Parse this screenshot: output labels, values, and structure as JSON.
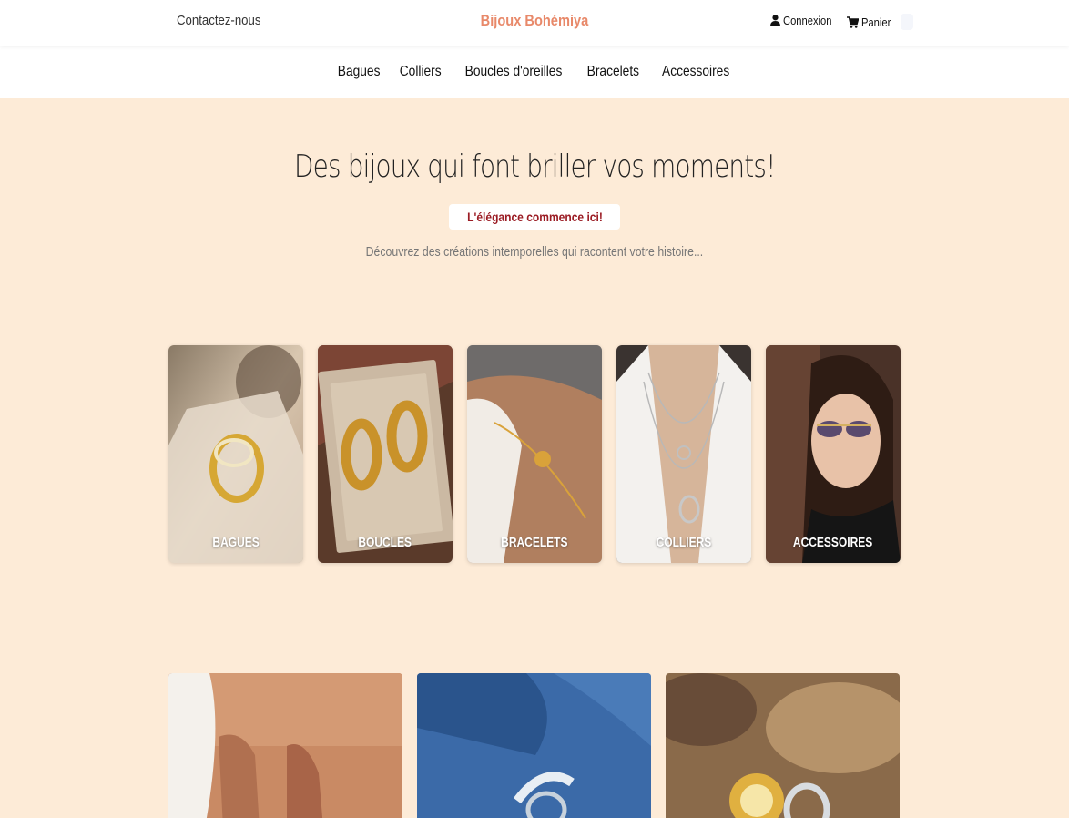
{
  "topbar": {
    "contact_label": "Contactez-nous",
    "brand": "Bijoux Bohémiya",
    "account_icon": "user-icon",
    "account_label": "Connexion",
    "cart_icon": "cart-icon",
    "cart_label": "Panier"
  },
  "nav": {
    "items": [
      {
        "label": "Bagues"
      },
      {
        "label": "Colliers"
      },
      {
        "label": "Boucles d'oreilles"
      },
      {
        "label": "Bracelets"
      },
      {
        "label": "Accessoires"
      }
    ]
  },
  "hero": {
    "title": "Des bijoux qui font briller vos moments!",
    "badge": "L'élégance commence ici!",
    "subtitle": "Découvrez des créations intemporelles qui racontent votre histoire..."
  },
  "categories": [
    {
      "label": "BAGUES"
    },
    {
      "label": "BOUCLES"
    },
    {
      "label": "BRACELETS"
    },
    {
      "label": "COLLIERS"
    },
    {
      "label": "ACCESSOIRES"
    }
  ],
  "colors": {
    "background": "#fdebd7",
    "brand": "#e8896a",
    "badge_text": "#9b1c24"
  }
}
